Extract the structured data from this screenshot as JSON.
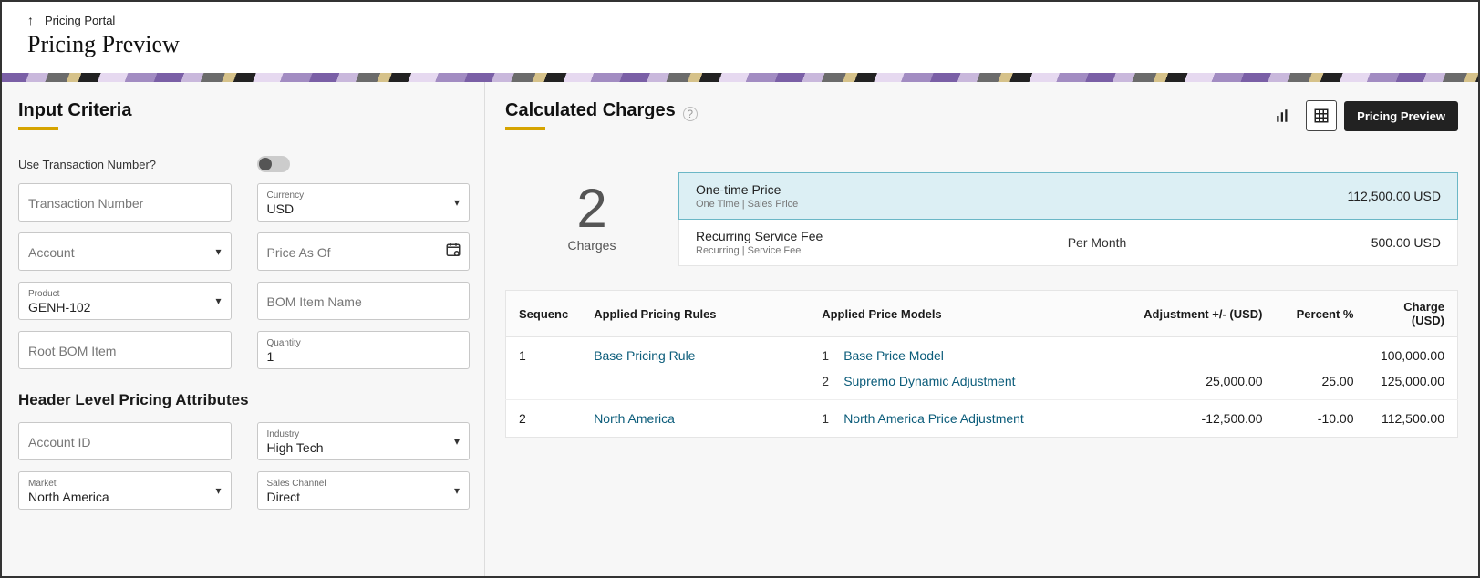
{
  "header": {
    "nav_up_label": "Pricing Portal",
    "page_title": "Pricing Preview"
  },
  "left": {
    "section_title": "Input Criteria",
    "use_tx_label": "Use Transaction Number?",
    "transaction_number_ph": "Transaction Number",
    "currency_label": "Currency",
    "currency_value": "USD",
    "account_ph": "Account",
    "price_as_of_ph": "Price As Of",
    "product_label": "Product",
    "product_value": "GENH-102",
    "bom_item_name_ph": "BOM Item Name",
    "root_bom_ph": "Root BOM Item",
    "quantity_label": "Quantity",
    "quantity_value": "1",
    "sub_title": "Header Level Pricing Attributes",
    "account_id_ph": "Account ID",
    "industry_label": "Industry",
    "industry_value": "High Tech",
    "market_label": "Market",
    "market_value": "North America",
    "sales_channel_label": "Sales Channel",
    "sales_channel_value": "Direct"
  },
  "right": {
    "section_title": "Calculated Charges",
    "pricing_preview_btn": "Pricing Preview",
    "count_value": "2",
    "count_label": "Charges",
    "charges": [
      {
        "name": "One-time Price",
        "sub": "One Time | Sales Price",
        "mid": "",
        "amount": "112,500.00 USD",
        "selected": true
      },
      {
        "name": "Recurring Service Fee",
        "sub": "Recurring | Service Fee",
        "mid": "Per Month",
        "amount": "500.00 USD",
        "selected": false
      }
    ],
    "columns": {
      "seq": "Sequenc",
      "rules": "Applied Pricing Rules",
      "models": "Applied Price Models",
      "adjustment": "Adjustment +/- (USD)",
      "percent": "Percent %",
      "charge": "Charge (USD)"
    },
    "rows": [
      {
        "seq": "1",
        "rule": "Base Pricing Rule",
        "models": [
          {
            "idx": "1",
            "name": "Base Price Model",
            "adjustment": "",
            "percent": "",
            "charge": "100,000.00"
          },
          {
            "idx": "2",
            "name": "Supremo Dynamic Adjustment",
            "adjustment": "25,000.00",
            "percent": "25.00",
            "charge": "125,000.00"
          }
        ]
      },
      {
        "seq": "2",
        "rule": "North America",
        "models": [
          {
            "idx": "1",
            "name": "North America Price Adjustment",
            "adjustment": "-12,500.00",
            "percent": "-10.00",
            "charge": "112,500.00"
          }
        ]
      }
    ]
  }
}
